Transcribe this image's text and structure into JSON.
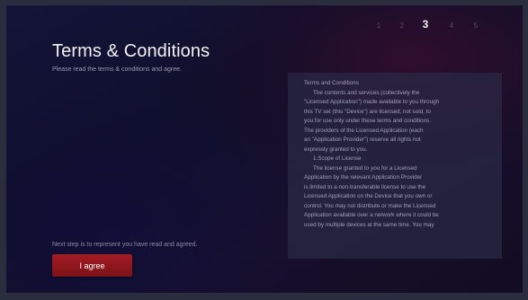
{
  "pager": {
    "steps": [
      "1",
      "2",
      "3",
      "4",
      "5"
    ],
    "current": 3
  },
  "header": {
    "title": "Terms & Conditions",
    "subtitle": "Please read the terms & conditions and agree."
  },
  "footer": {
    "next_step_text": "Next step is to represent you have read and agreed.",
    "agree_label": "I agree"
  },
  "terms": {
    "lines": [
      "Terms and Conditions",
      "The contents and services (collectively the",
      "\"Licensed Application\") made available to you through",
      "this TV set (this \"Device\") are licensed, not sold, to",
      "you for use only under these terms and conditions.",
      "The providers of the Licensed Application (each",
      "an \"Application Provider\") reserve all rights not",
      "expressly granted to you.",
      "1.Scope of License",
      "The license granted to you for a Licensed",
      "Application by the relevant Application Provider",
      "is limited to a non-transferable license to use the",
      "Licensed Application on the Device that you own or",
      "control. You may not distribute or make the Licensed",
      "Application available over a network where it could be",
      "used by multiple devices at the same time. You may"
    ]
  },
  "colors": {
    "accent_button": "#9a1a20",
    "background": "#14143a"
  }
}
